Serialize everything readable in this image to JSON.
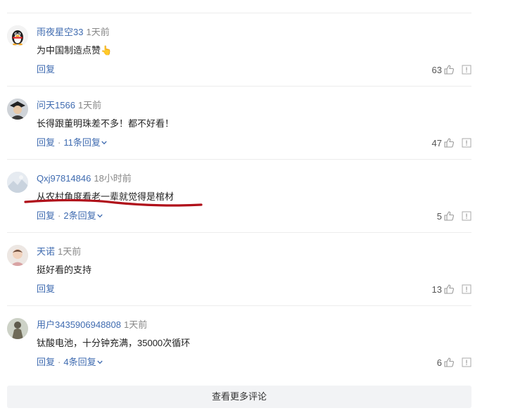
{
  "comments": [
    {
      "username": "雨夜星空33",
      "time": "1天前",
      "text": "为中国制造点赞👆",
      "reply_label": "回复",
      "replies_label": "",
      "likes": "63"
    },
    {
      "username": "问天1566",
      "time": "1天前",
      "text": "长得跟董明珠差不多！都不好看！",
      "reply_label": "回复",
      "replies_label": "11条回复",
      "likes": "47"
    },
    {
      "username": "Qxj97814846",
      "time": "18小时前",
      "text": "从农村角度看老一辈就觉得是棺材",
      "reply_label": "回复",
      "replies_label": "2条回复",
      "likes": "5"
    },
    {
      "username": "天诺",
      "time": "1天前",
      "text": "挺好看的支持",
      "reply_label": "回复",
      "replies_label": "",
      "likes": "13"
    },
    {
      "username": "用户3435906948808",
      "time": "1天前",
      "text": "钛酸电池，十分钟充满，35000次循环",
      "reply_label": "回复",
      "replies_label": "4条回复",
      "likes": "6"
    }
  ],
  "dot_separator": "·",
  "more_comments_label": "查看更多评论",
  "colors": {
    "username": "#3f6bb0",
    "annotation": "#b0101a"
  }
}
